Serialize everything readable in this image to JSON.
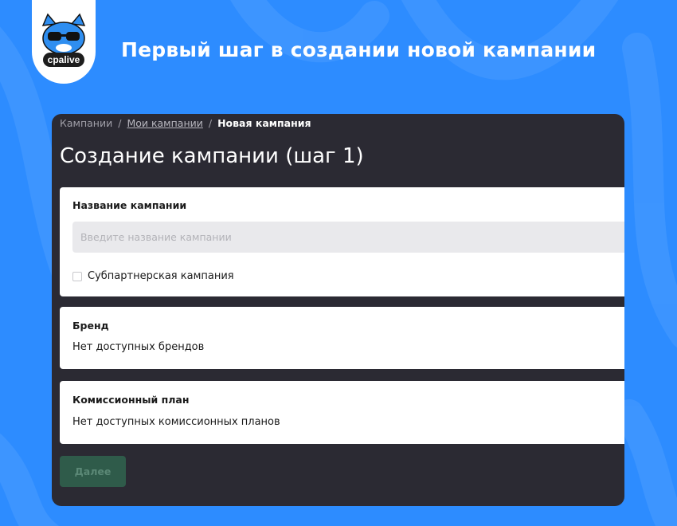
{
  "banner": {
    "logo_text": "cpalive",
    "title": "Первый шаг в создании новой кампании"
  },
  "breadcrumb": {
    "items": [
      "Кампании",
      "Мои кампании",
      "Новая кампания"
    ],
    "separator": "/"
  },
  "page": {
    "title": "Создание кампании (шаг 1)"
  },
  "campaign_name": {
    "label": "Название кампании",
    "value": "",
    "placeholder": "Введите название кампании"
  },
  "subpartner": {
    "label": "Субпартнерская кампания",
    "checked": false
  },
  "brand": {
    "label": "Бренд",
    "value": "Нет доступных брендов"
  },
  "commission_plan": {
    "label": "Комиссионный план",
    "value": "Нет доступных комиссионных планов"
  },
  "actions": {
    "next_label": "Далее"
  },
  "colors": {
    "background": "#2d8cff",
    "panel": "#2b2a33",
    "next_button": "#2f5b4a"
  }
}
